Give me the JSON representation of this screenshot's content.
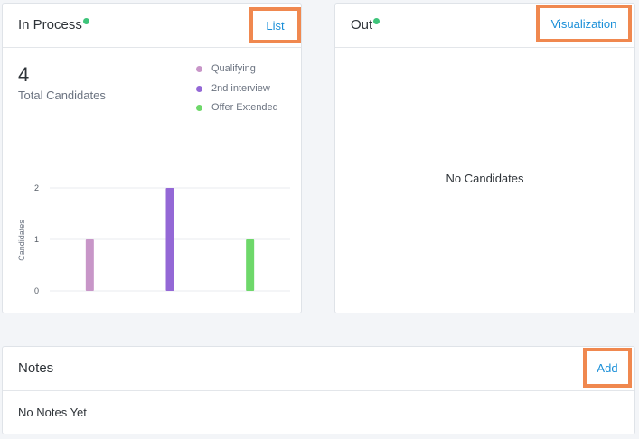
{
  "in_process": {
    "title": "In Process",
    "action_label": "List",
    "count": "4",
    "count_label": "Total Candidates",
    "legend": [
      {
        "label": "Qualifying",
        "color": "#c896c8"
      },
      {
        "label": "2nd interview",
        "color": "#9468d6"
      },
      {
        "label": "Offer Extended",
        "color": "#6ed86a"
      }
    ]
  },
  "out": {
    "title": "Out",
    "action_label": "Visualization",
    "empty_text": "No Candidates"
  },
  "notes": {
    "title": "Notes",
    "action_label": "Add",
    "empty_text": "No Notes Yet"
  },
  "chart_data": {
    "type": "bar",
    "categories": [
      "Qualifying",
      "2nd interview",
      "Offer Extended"
    ],
    "values": [
      1,
      2,
      1
    ],
    "colors": [
      "#c896c8",
      "#9468d6",
      "#6ed86a"
    ],
    "ylabel": "Candidates",
    "ylim": [
      0,
      2
    ],
    "yticks": [
      "0",
      "1",
      "2"
    ],
    "grid": true
  }
}
